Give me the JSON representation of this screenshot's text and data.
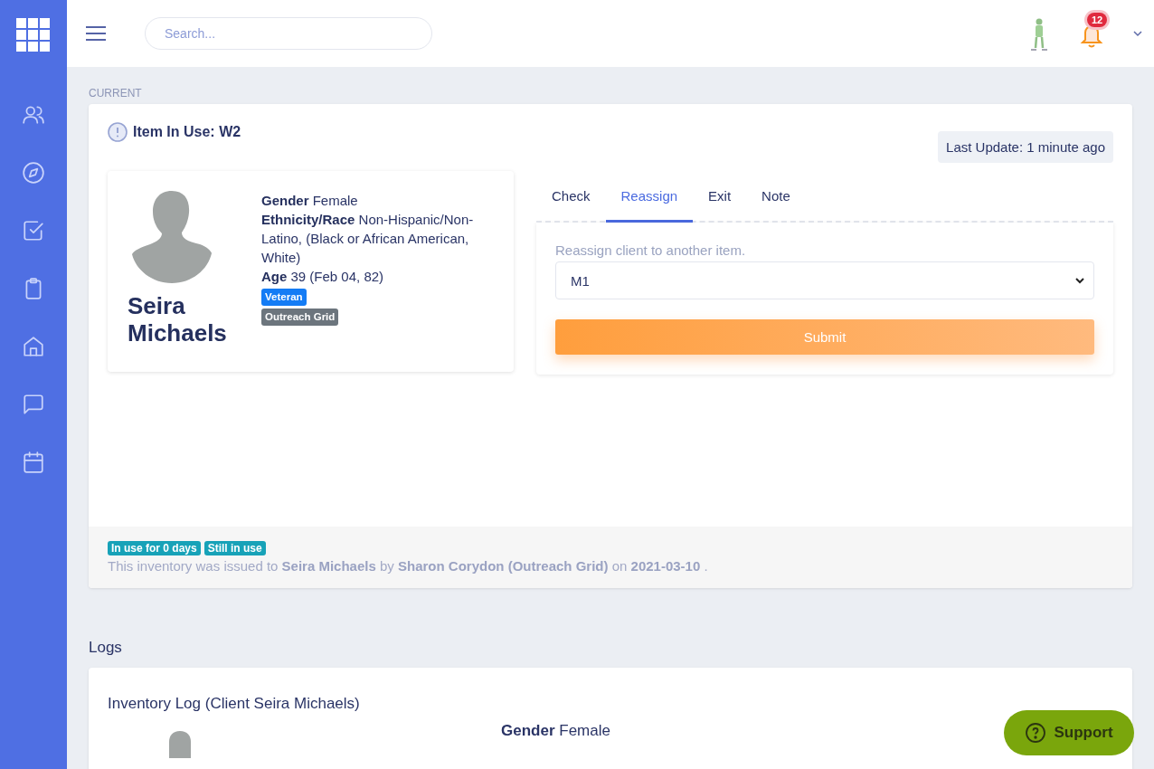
{
  "search": {
    "placeholder": "Search..."
  },
  "notifications": {
    "count": "12"
  },
  "section_label": "CURRENT",
  "item": {
    "title": "Item In Use: W2",
    "last_update": "Last Update: 1 minute ago"
  },
  "client": {
    "name": "Seira Michaels",
    "fields": [
      "**Gender** Female",
      "**Ethnicity/Race** Non-Hispanic/Non-Latino, (Black or African American, White)",
      "**Age** 39 (Feb 04, 82)"
    ],
    "tags": [
      {
        "text": "Veteran",
        "color": "#147cf5"
      },
      {
        "text": "Outreach Grid",
        "color": "#6c757d"
      }
    ]
  },
  "tabs": [
    {
      "label": "Check",
      "selected": false
    },
    {
      "label": "Reassign",
      "selected": true
    },
    {
      "label": "Exit",
      "selected": false
    },
    {
      "label": "Note",
      "selected": false
    }
  ],
  "reassign": {
    "label": "Reassign client to another item.",
    "value": "M1",
    "button": "Submit"
  },
  "usage": {
    "badges": [
      "In use for 0 days",
      "Still in use"
    ],
    "sentence": "This inventory was issued to **Seira Michaels** by **Sharon Corydon (Outreach Grid)** on **2021-03-10** ."
  },
  "logs": {
    "heading": "Logs",
    "title": "Inventory Log (Client Seira Michaels)",
    "fields": [
      "**Gender** Female"
    ]
  },
  "support": {
    "label": "Support"
  }
}
